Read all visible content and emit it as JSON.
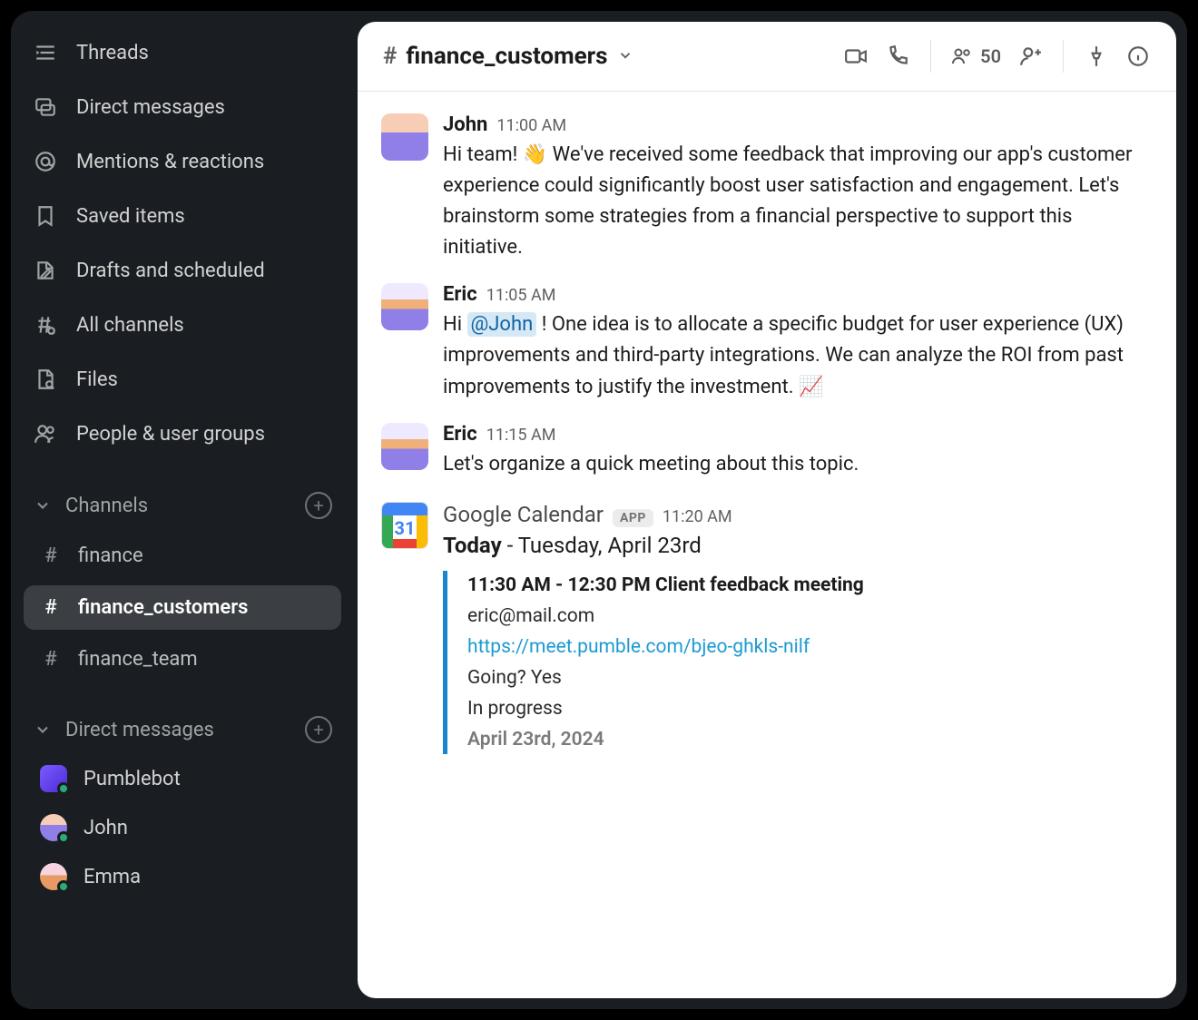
{
  "sidebar": {
    "nav": [
      {
        "icon": "threads",
        "label": "Threads"
      },
      {
        "icon": "dm",
        "label": "Direct messages"
      },
      {
        "icon": "mentions",
        "label": "Mentions & reactions"
      },
      {
        "icon": "saved",
        "label": "Saved items"
      },
      {
        "icon": "drafts",
        "label": "Drafts and scheduled"
      },
      {
        "icon": "allchannels",
        "label": "All channels"
      },
      {
        "icon": "files",
        "label": "Files"
      },
      {
        "icon": "people",
        "label": "People & user groups"
      }
    ],
    "channels_header": "Channels",
    "channels": [
      {
        "name": "finance",
        "active": false
      },
      {
        "name": "finance_customers",
        "active": true
      },
      {
        "name": "finance_team",
        "active": false
      }
    ],
    "dm_header": "Direct messages",
    "dms": [
      {
        "name": "Pumblebot",
        "avatar": "bot"
      },
      {
        "name": "John",
        "avatar": "john"
      },
      {
        "name": "Emma",
        "avatar": "emma"
      }
    ]
  },
  "header": {
    "channel_name": "finance_customers",
    "member_count": "50"
  },
  "messages": [
    {
      "author": "John",
      "avatar": "john",
      "time": "11:00 AM",
      "text_pre": "Hi team! ",
      "emoji": "👋",
      "text_post": " We've received some feedback that improving our app's customer experience could significantly boost user satisfaction and engagement. Let's brainstorm some strategies from a financial perspective to support this initiative."
    },
    {
      "author": "Eric",
      "avatar": "eric",
      "time": "11:05 AM",
      "text_pre": "Hi ",
      "mention": "@John",
      "text_post": " ! One idea is to allocate a specific budget for user experience (UX) improvements and third-party integrations. We can analyze the ROI from past improvements to justify the investment. 📈"
    },
    {
      "author": "Eric",
      "avatar": "eric",
      "time": "11:15 AM",
      "text": "Let's organize a quick meeting about this topic."
    }
  ],
  "calendar": {
    "app_name": "Google Calendar",
    "app_badge": "APP",
    "time": "11:20 AM",
    "today_label": "Today",
    "date_rest": " - Tuesday, April 23rd",
    "icon_day": "31",
    "event": {
      "title": "11:30 AM - 12:30 PM Client feedback meeting",
      "email": "eric@mail.com",
      "link": "https://meet.pumble.com/bjeo-ghkls-nilf",
      "going": "Going? Yes",
      "status": "In progress",
      "date": "April 23rd, 2024"
    }
  }
}
